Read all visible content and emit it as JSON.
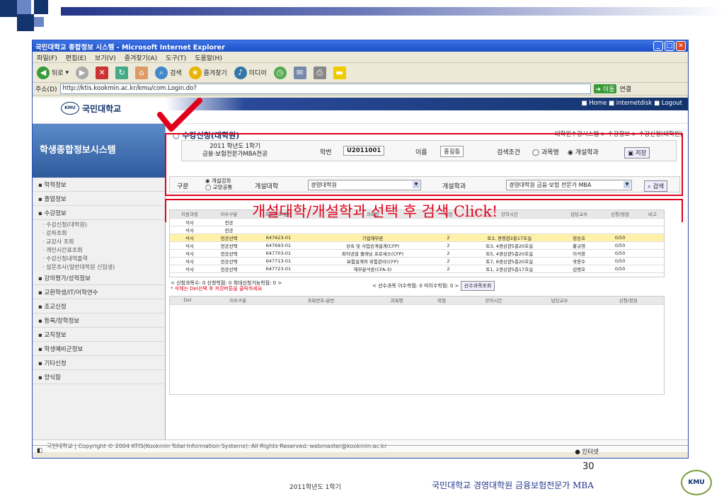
{
  "window": {
    "title": "국민대학교 종합정보 시스템 - Microsoft Internet Explorer"
  },
  "menu": [
    "파일(F)",
    "편집(E)",
    "보기(V)",
    "즐겨찾기(A)",
    "도구(T)",
    "도움말(H)"
  ],
  "toolbar": {
    "back": "뒤로",
    "search": "검색",
    "favorites": "즐겨찾기",
    "media": "미디어"
  },
  "address": {
    "label": "주소(D)",
    "url": "http://ktis.kookmin.ac.kr/kmu/com.Login.do?",
    "go": "이동",
    "links": "연결"
  },
  "site": {
    "logo": "국민대학교",
    "logo_sub": "KOOKMIN UNIVERSITY",
    "top_links": "■ Home  ■ internetdisk  ■ Logout"
  },
  "sidebar": {
    "title": "학생종합정보시스템",
    "items": [
      "학적정보",
      "졸업정보",
      "수강정보"
    ],
    "subitems": [
      "수강신청(대학원)",
      "강좌조회",
      "교강사 조회",
      "개인시간표조회",
      "수강신청내역출력",
      "설문조사(일반대학원 신입생)"
    ],
    "items2": [
      "강의평가/성적정보",
      "교환학생/IT/어학연수",
      "조교신청",
      "등록/장학정보",
      "교직정보",
      "학생예비군정보",
      "기타신청",
      "양식함"
    ]
  },
  "main": {
    "title": "수강신청(대학원)",
    "breadcrumb": "대학원수강시스템 > 수강정보 > 수강신청(대학원)",
    "term": "2011 학년도 1학기",
    "dept": "금융·보험전문가MBA전공",
    "sid_label": "학번",
    "sid": "U2011001",
    "name_label": "이름",
    "name": "홍길동",
    "cond_label": "검색조건",
    "opt1": "과목명",
    "opt2": "개설학과",
    "save": "저장",
    "gubun_label": "구분",
    "radio1": "개설강좌",
    "radio2": "교양공통",
    "college_label": "개설대학",
    "college": "경영대학원",
    "dept_label": "개설학과",
    "dept_value": "경영대학원 금융·보험 전문가 MBA",
    "search_btn": "검색"
  },
  "table": {
    "headers": [
      "지원과정",
      "이수구분",
      "과목번호-분반",
      "과목명",
      "학점",
      "강의시간",
      "담당교수",
      "신청/정원",
      "비고"
    ],
    "rows": [
      [
        "석사",
        "전공",
        "",
        "",
        "",
        "",
        "",
        "",
        ""
      ],
      [
        "석사",
        "전공",
        "",
        "",
        "",
        "",
        "",
        "",
        ""
      ],
      [
        "석사",
        "전공선택",
        "647623-01",
        "기업재무론",
        "2",
        "토3, 경영관2층17호실",
        "정승호",
        "0/50",
        ""
      ],
      [
        "석사",
        "전공선택",
        "647693-01",
        "상속 및 사업승계설계(CFP)",
        "2",
        "토3, 4경상관5층20호실",
        "황규영",
        "0/50",
        ""
      ],
      [
        "석사",
        "전공선택",
        "647703-01",
        "파이낸셜 플래닝 프로세스(CFP)",
        "2",
        "토5, 4경상관5층20호실",
        "이석용",
        "0/50",
        ""
      ],
      [
        "석사",
        "전공선택",
        "647713-01",
        "보험설계와 위험관리(CFP)",
        "2",
        "토7, 8경상관5층20호실",
        "곽용수",
        "0/50",
        ""
      ],
      [
        "석사",
        "전공선택",
        "647723-01",
        "재무분석론(CFA-3)",
        "2",
        "토1, 2경상관5층17호실",
        "김병호",
        "0/50",
        ""
      ]
    ]
  },
  "summary": {
    "line1": "< 신청과목수: 0  신청학점: 0  최대신청가능학점: 0 >",
    "line2": "* 삭제는 Del선택 후 저장버튼을 클릭하세요",
    "line3": "< 선수과목 이수학점: 0  미이수학점: 0 >",
    "prereq_btn": "선수과목조회"
  },
  "table2": {
    "headers": [
      "Del",
      "이수구분",
      "과목번호-분반",
      "과목명",
      "학점",
      "강의시간",
      "담당교수",
      "신청/정원"
    ]
  },
  "footer": {
    "copyright": "국민대학교 | Copyright © 2004 KTIS(Kookmin Total Information Systems). All Rights Reserved. webmaster@kookmin.ac.kr"
  },
  "status": {
    "zone": "인터넷"
  },
  "annotation": {
    "text": "개설대학/개설학과 선택 후 검색 Click!"
  },
  "slide": {
    "page": "30",
    "term": "2011학년도 1학기",
    "caption": "국민대학교 경영대학원 금융보험전문가 MBA",
    "badge": "KMU"
  },
  "colors": {
    "accent": "#e0001b",
    "navy": "#12336b"
  }
}
